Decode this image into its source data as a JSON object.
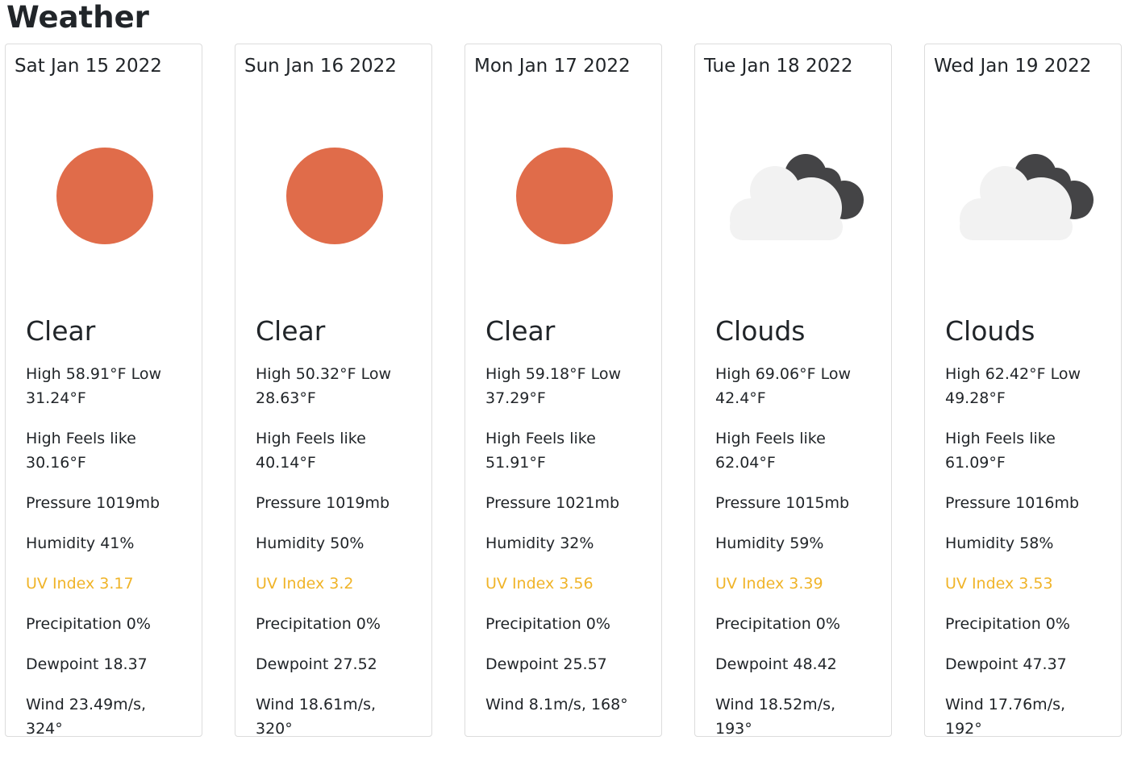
{
  "header": {
    "title": "Weather"
  },
  "days": [
    {
      "date": "Sat Jan 15 2022",
      "icon": "sun-icon",
      "condition": "Clear",
      "temp": "High 58.91°F Low 31.24°F",
      "feels": "High Feels like 30.16°F",
      "pressure": "Pressure 1019mb",
      "humidity": "Humidity 41%",
      "uv": "UV Index 3.17",
      "precip": "Precipitation 0%",
      "dewpoint": "Dewpoint 18.37",
      "wind": "Wind 23.49m/s, 324°"
    },
    {
      "date": "Sun Jan 16 2022",
      "icon": "sun-icon",
      "condition": "Clear",
      "temp": "High 50.32°F Low 28.63°F",
      "feels": "High Feels like 40.14°F",
      "pressure": "Pressure 1019mb",
      "humidity": "Humidity 50%",
      "uv": "UV Index 3.2",
      "precip": "Precipitation 0%",
      "dewpoint": "Dewpoint 27.52",
      "wind": "Wind 18.61m/s, 320°"
    },
    {
      "date": "Mon Jan 17 2022",
      "icon": "sun-icon",
      "condition": "Clear",
      "temp": "High 59.18°F Low 37.29°F",
      "feels": "High Feels like 51.91°F",
      "pressure": "Pressure 1021mb",
      "humidity": "Humidity 32%",
      "uv": "UV Index 3.56",
      "precip": "Precipitation 0%",
      "dewpoint": "Dewpoint 25.57",
      "wind": "Wind 8.1m/s, 168°"
    },
    {
      "date": "Tue Jan 18 2022",
      "icon": "clouds-icon",
      "condition": "Clouds",
      "temp": "High 69.06°F Low 42.4°F",
      "feels": "High Feels like 62.04°F",
      "pressure": "Pressure 1015mb",
      "humidity": "Humidity 59%",
      "uv": "UV Index 3.39",
      "precip": "Precipitation 0%",
      "dewpoint": "Dewpoint 48.42",
      "wind": "Wind 18.52m/s, 193°"
    },
    {
      "date": "Wed Jan 19 2022",
      "icon": "clouds-icon",
      "condition": "Clouds",
      "temp": "High 62.42°F Low 49.28°F",
      "feels": "High Feels like 61.09°F",
      "pressure": "Pressure 1016mb",
      "humidity": "Humidity 58%",
      "uv": "UV Index 3.53",
      "precip": "Precipitation 0%",
      "dewpoint": "Dewpoint 47.37",
      "wind": "Wind 17.76m/s, 192°"
    }
  ],
  "colors": {
    "sun": "#e06c4a",
    "cloud_light": "#f2f2f2",
    "cloud_dark": "#444446",
    "uv_text": "#f0b429"
  }
}
